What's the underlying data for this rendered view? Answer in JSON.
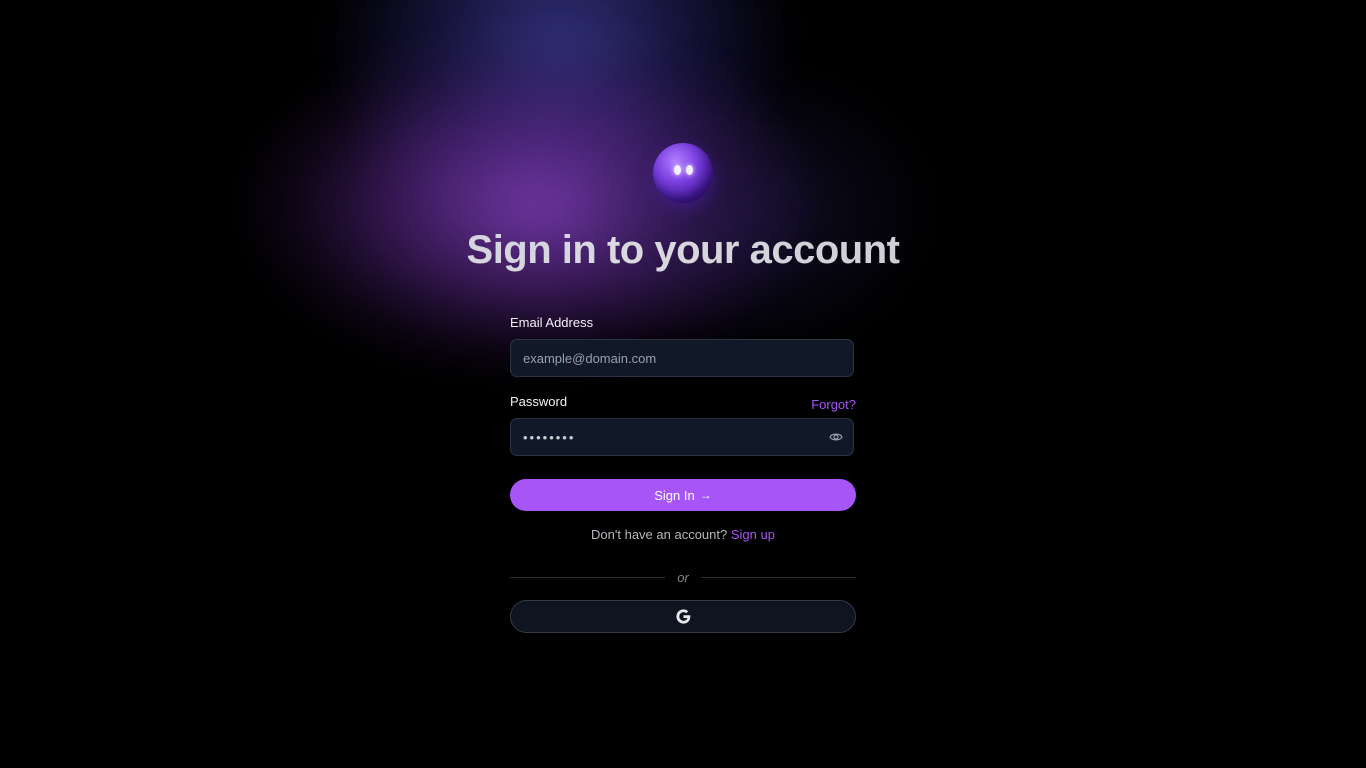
{
  "page": {
    "title": "Sign in to your account"
  },
  "colors": {
    "accent": "#a855f7",
    "background": "#000000",
    "field_bg": "#111827"
  },
  "form": {
    "email": {
      "label": "Email Address",
      "placeholder": "example@domain.com",
      "value": ""
    },
    "password": {
      "label": "Password",
      "value": "••••••••",
      "forgot_label": "Forgot?",
      "toggle_icon": "eye-icon"
    },
    "submit_label": "Sign In",
    "submit_icon": "arrow-right-icon",
    "signup_prompt": "Don't have an account?",
    "signup_link": "Sign up",
    "divider_text": "or",
    "social": {
      "icon": "google-icon"
    }
  },
  "logo": {
    "icon": "orb-mascot-icon"
  }
}
